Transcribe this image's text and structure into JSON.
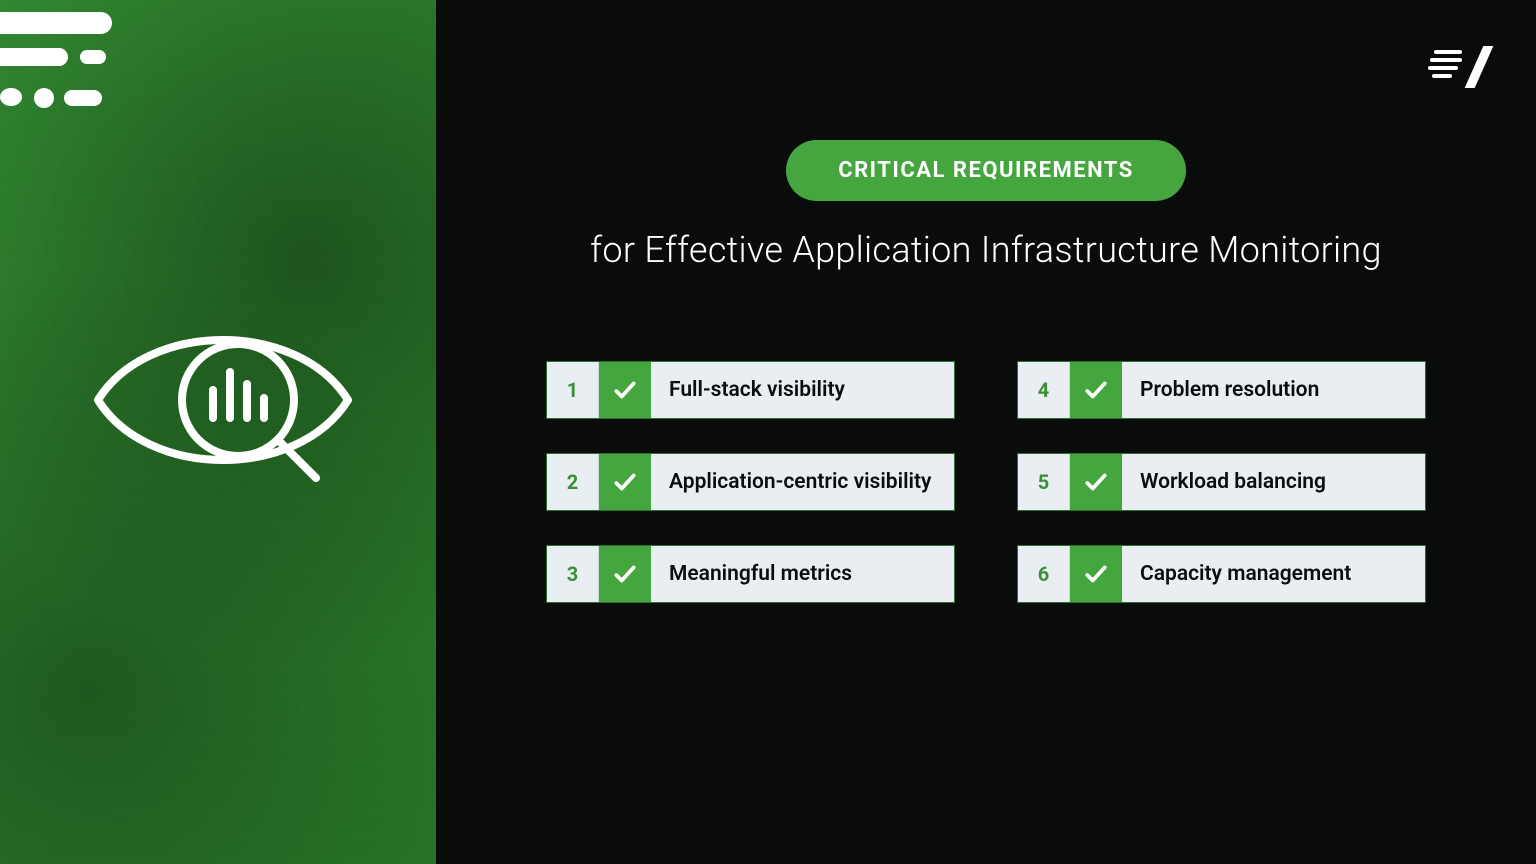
{
  "header": {
    "pill_label": "CRITICAL REQUIREMENTS",
    "subtitle": "for Effective Application Infrastructure Monitoring"
  },
  "colors": {
    "accent_green": "#45a53f",
    "panel_green": "#3aa13a",
    "item_bg": "#e9eef3",
    "text_dark": "#0c0d0d"
  },
  "requirements_left": [
    {
      "num": "1",
      "label": "Full-stack visibility"
    },
    {
      "num": "2",
      "label": "Application-centric visibility"
    },
    {
      "num": "3",
      "label": "Meaningful metrics"
    }
  ],
  "requirements_right": [
    {
      "num": "4",
      "label": "Problem resolution"
    },
    {
      "num": "5",
      "label": "Workload balancing"
    },
    {
      "num": "6",
      "label": "Capacity management"
    }
  ]
}
